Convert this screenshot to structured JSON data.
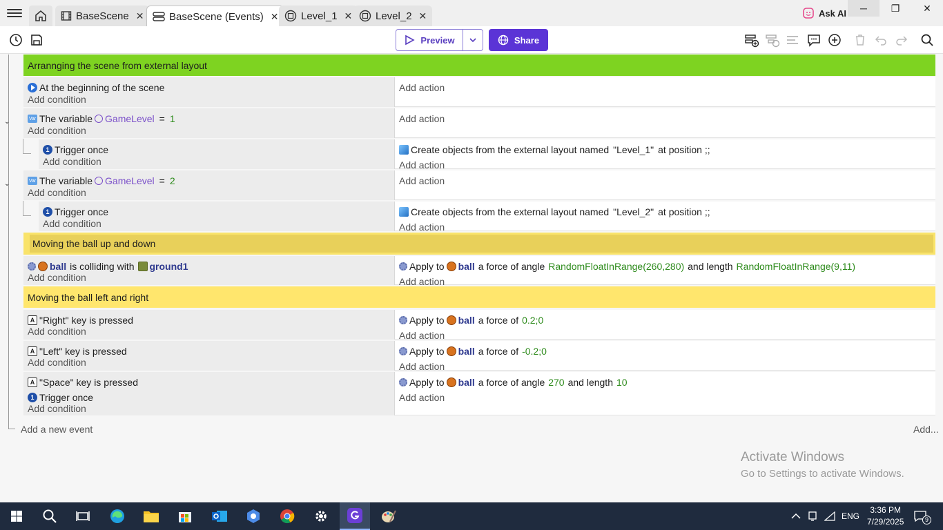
{
  "tabs": [
    {
      "label": "BaseScene",
      "icon": "scene-icon"
    },
    {
      "label": "BaseScene (Events)",
      "icon": "events-icon"
    },
    {
      "label": "Level_1",
      "icon": "layout-icon"
    },
    {
      "label": "Level_2",
      "icon": "layout-icon"
    }
  ],
  "header": {
    "ask_ai": "Ask AI"
  },
  "toolbar": {
    "preview": "Preview",
    "share": "Share"
  },
  "common": {
    "add_condition": "Add condition",
    "add_action": "Add action"
  },
  "groups": {
    "g1": "Arrannging the scene from external layout",
    "g2": "Moving the ball up and down",
    "g3": "Moving the ball left and right"
  },
  "events": {
    "e1": {
      "cond": "At the beginning of the scene"
    },
    "e2": {
      "cond_pre": "The variable",
      "var": "GameLevel",
      "op": "=",
      "val": "1"
    },
    "e3": {
      "cond": "Trigger once",
      "act_pre": "Create objects from the external layout named",
      "act_name": "\"Level_1\"",
      "act_post": "at position ;;"
    },
    "e4": {
      "cond_pre": "The variable",
      "var": "GameLevel",
      "op": "=",
      "val": "2"
    },
    "e5": {
      "cond": "Trigger once",
      "act_pre": "Create objects from the external layout named",
      "act_name": "\"Level_2\"",
      "act_post": "at position ;;"
    },
    "e6": {
      "obj": "ball",
      "mid": "is colliding with",
      "obj2": "ground1",
      "act_pre": "Apply to",
      "act_obj": "ball",
      "act_mid": "a force of angle",
      "angle": "RandomFloatInRange(260,280)",
      "act_mid2": "and length",
      "length": "RandomFloatInRange(9,11)"
    },
    "e7": {
      "cond": "\"Right\" key is pressed",
      "act_pre": "Apply to",
      "act_obj": "ball",
      "act_mid": "a force of",
      "force": "0.2;0"
    },
    "e8": {
      "cond": "\"Left\" key is pressed",
      "act_pre": "Apply to",
      "act_obj": "ball",
      "act_mid": "a force of",
      "force": "-0.2;0"
    },
    "e9": {
      "cond": "\"Space\" key is pressed",
      "cond2": "Trigger once",
      "act_pre": "Apply to",
      "act_obj": "ball",
      "act_mid": "a force of angle",
      "angle": "270",
      "act_mid2": "and length",
      "length": "10"
    }
  },
  "footer": {
    "add_event": "Add a new event",
    "add_more": "Add..."
  },
  "watermark": {
    "title": "Activate Windows",
    "subtitle": "Go to Settings to activate Windows."
  },
  "taskbar": {
    "lang": "ENG",
    "time": "3:36 PM",
    "date": "7/29/2025",
    "notif_count": "9"
  }
}
